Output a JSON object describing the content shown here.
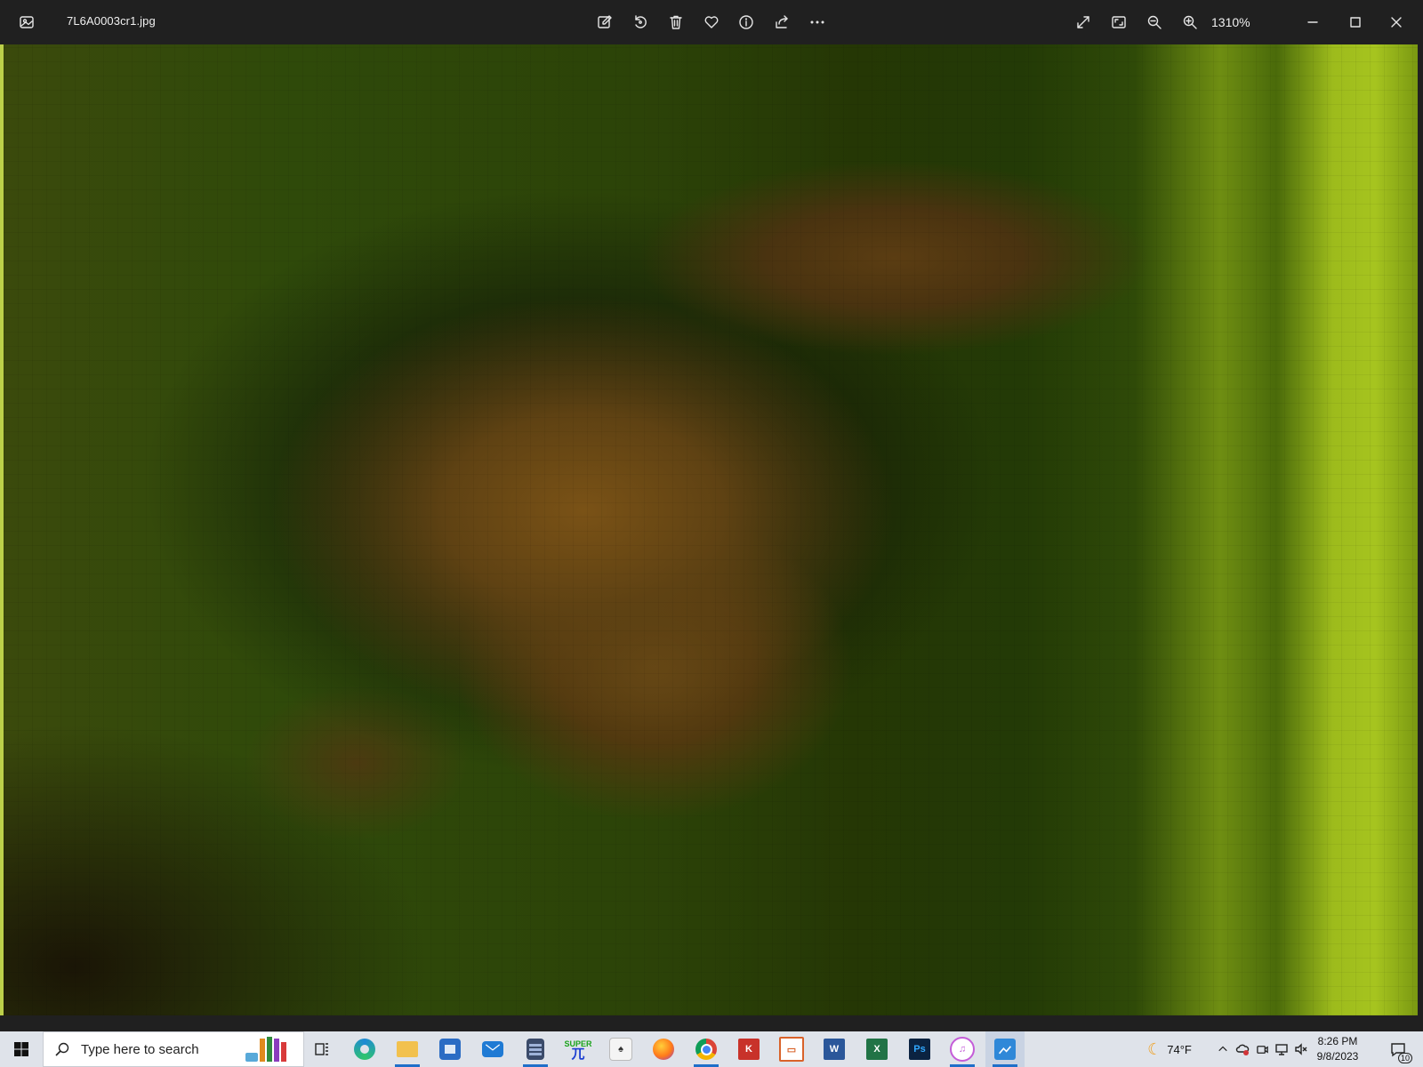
{
  "window": {
    "file_name": "7L6A0003cr1.jpg",
    "zoom_level": "1310%"
  },
  "toolbar": {
    "buttons": [
      "edit-image",
      "rotate",
      "delete",
      "favorite",
      "file-info",
      "share",
      "see-more"
    ],
    "view_buttons": [
      "full-screen",
      "fit-to-window",
      "zoom-out",
      "zoom-in"
    ]
  },
  "photo": {
    "description_colors": {
      "background_green": "#2c4308",
      "bright_green": "#a6c41f",
      "subject_brown": "#6a4a16"
    }
  },
  "taskbar": {
    "search_placeholder": "Type here to search",
    "pinned_apps": [
      "library-books-icon",
      "task-view-icon",
      "edge-icon",
      "file-explorer-icon",
      "store-icon",
      "mail-icon",
      "calculator-icon",
      "super-icon",
      "solitaire-icon",
      "firefox-icon",
      "chrome-icon",
      "app-red-icon",
      "app-orange-icon",
      "word-icon",
      "excel-icon",
      "photoshop-icon",
      "itunes-icon",
      "photos-icon"
    ],
    "super_label": "SUPER",
    "super_glyph": "兀",
    "photoshop_label": "Ps",
    "word_label": "W",
    "excel_label": "X",
    "weather": "74°F",
    "time": "8:26 PM",
    "date": "9/8/2023",
    "notification_count": "10",
    "accent_color": "#1f6fc9"
  }
}
